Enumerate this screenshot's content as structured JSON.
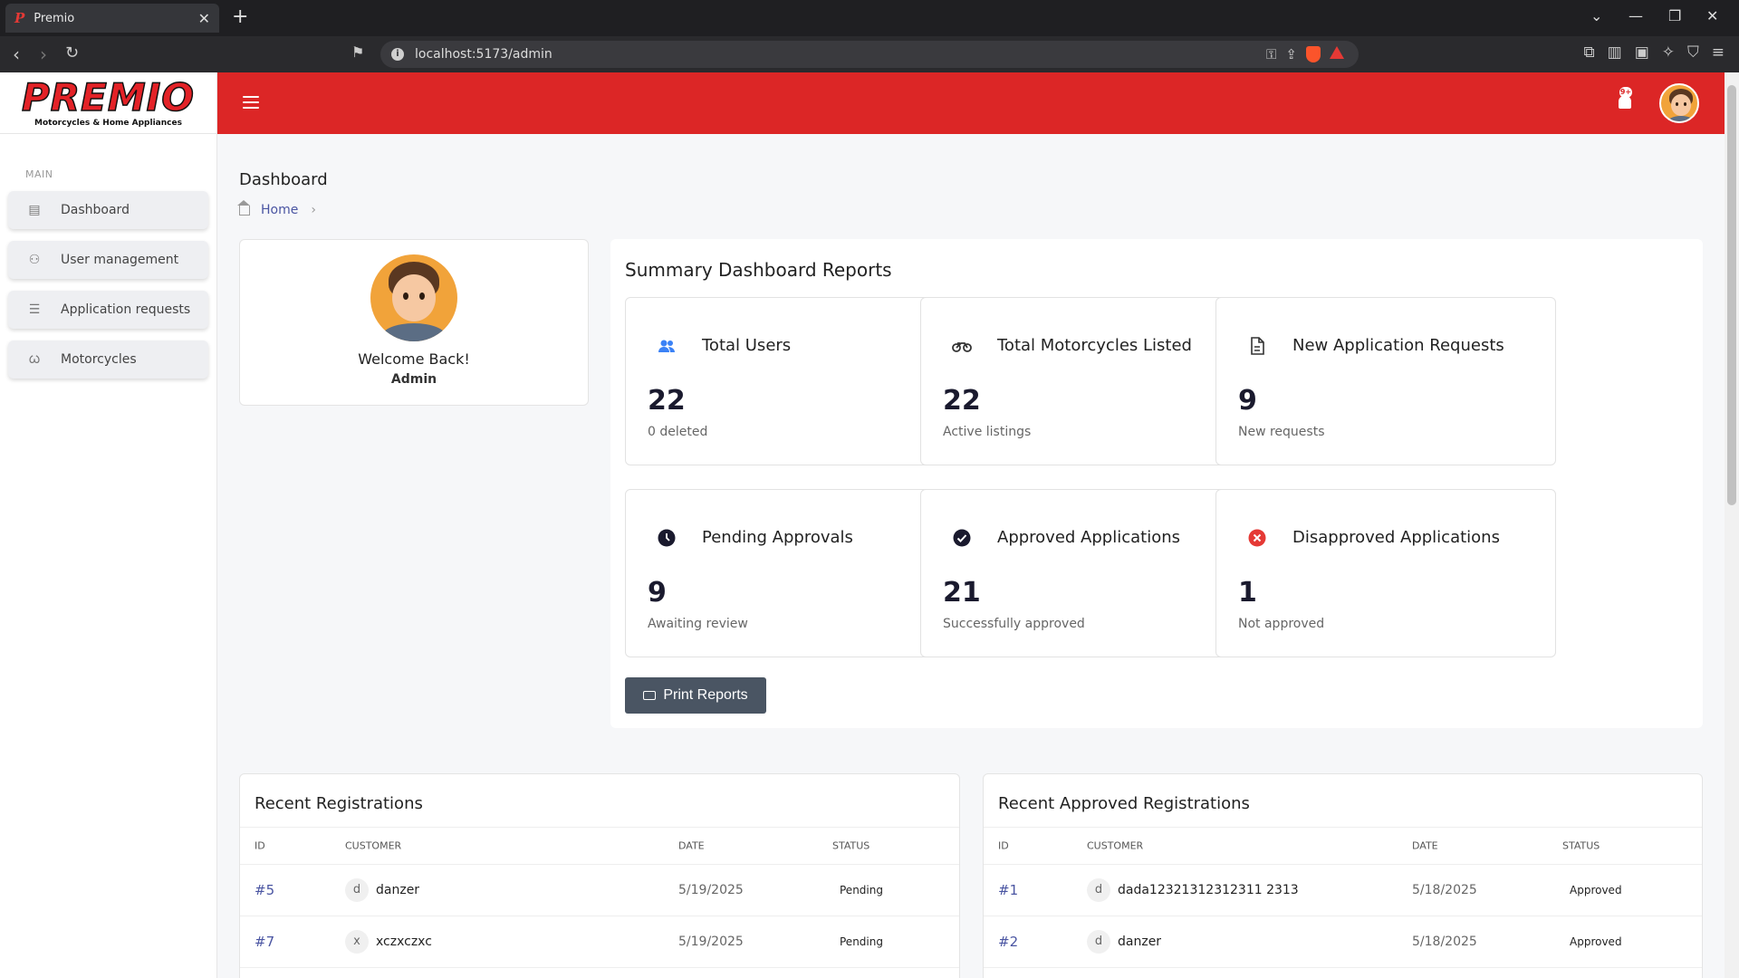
{
  "browser": {
    "tab_title": "Premio",
    "tab_favicon": "P",
    "url": "localhost:5173/admin"
  },
  "sidebar": {
    "brand": "PREMIO",
    "tagline": "Motorcycles & Home Appliances",
    "section_label": "MAIN",
    "items": [
      {
        "label": "Dashboard",
        "icon": "table-icon"
      },
      {
        "label": "User management",
        "icon": "users-icon"
      },
      {
        "label": "Application requests",
        "icon": "document-icon"
      },
      {
        "label": "Motorcycles",
        "icon": "motorcycle-icon"
      }
    ]
  },
  "header": {
    "notification_badge": "9+",
    "accent": "#dc2626"
  },
  "page": {
    "title": "Dashboard",
    "breadcrumb": "Home"
  },
  "welcome": {
    "greeting": "Welcome Back!",
    "role": "Admin"
  },
  "summary": {
    "title": "Summary Dashboard Reports",
    "print_label": "Print Reports",
    "cards": [
      {
        "label": "Total Users",
        "value": "22",
        "sub": "0 deleted",
        "icon": "users-icon",
        "icon_color": "#3b82f6"
      },
      {
        "label": "Total Motorcycles Listed",
        "value": "22",
        "sub": "Active listings",
        "icon": "motorcycle-icon",
        "icon_color": "#333333"
      },
      {
        "label": "New Application Requests",
        "value": "9",
        "sub": "New requests",
        "icon": "document-icon",
        "icon_color": "#333333"
      },
      {
        "label": "Pending Approvals",
        "value": "9",
        "sub": "Awaiting review",
        "icon": "clock-icon",
        "icon_color": "#1a1a2e"
      },
      {
        "label": "Approved Applications",
        "value": "21",
        "sub": "Successfully approved",
        "icon": "check-circle-icon",
        "icon_color": "#1a1a2e"
      },
      {
        "label": "Disapproved Applications",
        "value": "1",
        "sub": "Not approved",
        "icon": "x-circle-icon",
        "icon_color": "#e53935"
      }
    ]
  },
  "recent_registrations": {
    "title": "Recent Registrations",
    "columns": [
      "ID",
      "CUSTOMER",
      "DATE",
      "STATUS"
    ],
    "rows": [
      {
        "id": "#5",
        "initial": "d",
        "customer": "danzer",
        "date": "5/19/2025",
        "status": "Pending"
      },
      {
        "id": "#7",
        "initial": "x",
        "customer": "xczxczxc",
        "date": "5/19/2025",
        "status": "Pending"
      }
    ]
  },
  "recent_approved": {
    "title": "Recent Approved Registrations",
    "columns": [
      "ID",
      "CUSTOMER",
      "DATE",
      "STATUS"
    ],
    "rows": [
      {
        "id": "#1",
        "initial": "d",
        "customer": "dada12321312312311 2313",
        "date": "5/18/2025",
        "status": "Approved"
      },
      {
        "id": "#2",
        "initial": "d",
        "customer": "danzer",
        "date": "5/18/2025",
        "status": "Approved"
      }
    ]
  }
}
